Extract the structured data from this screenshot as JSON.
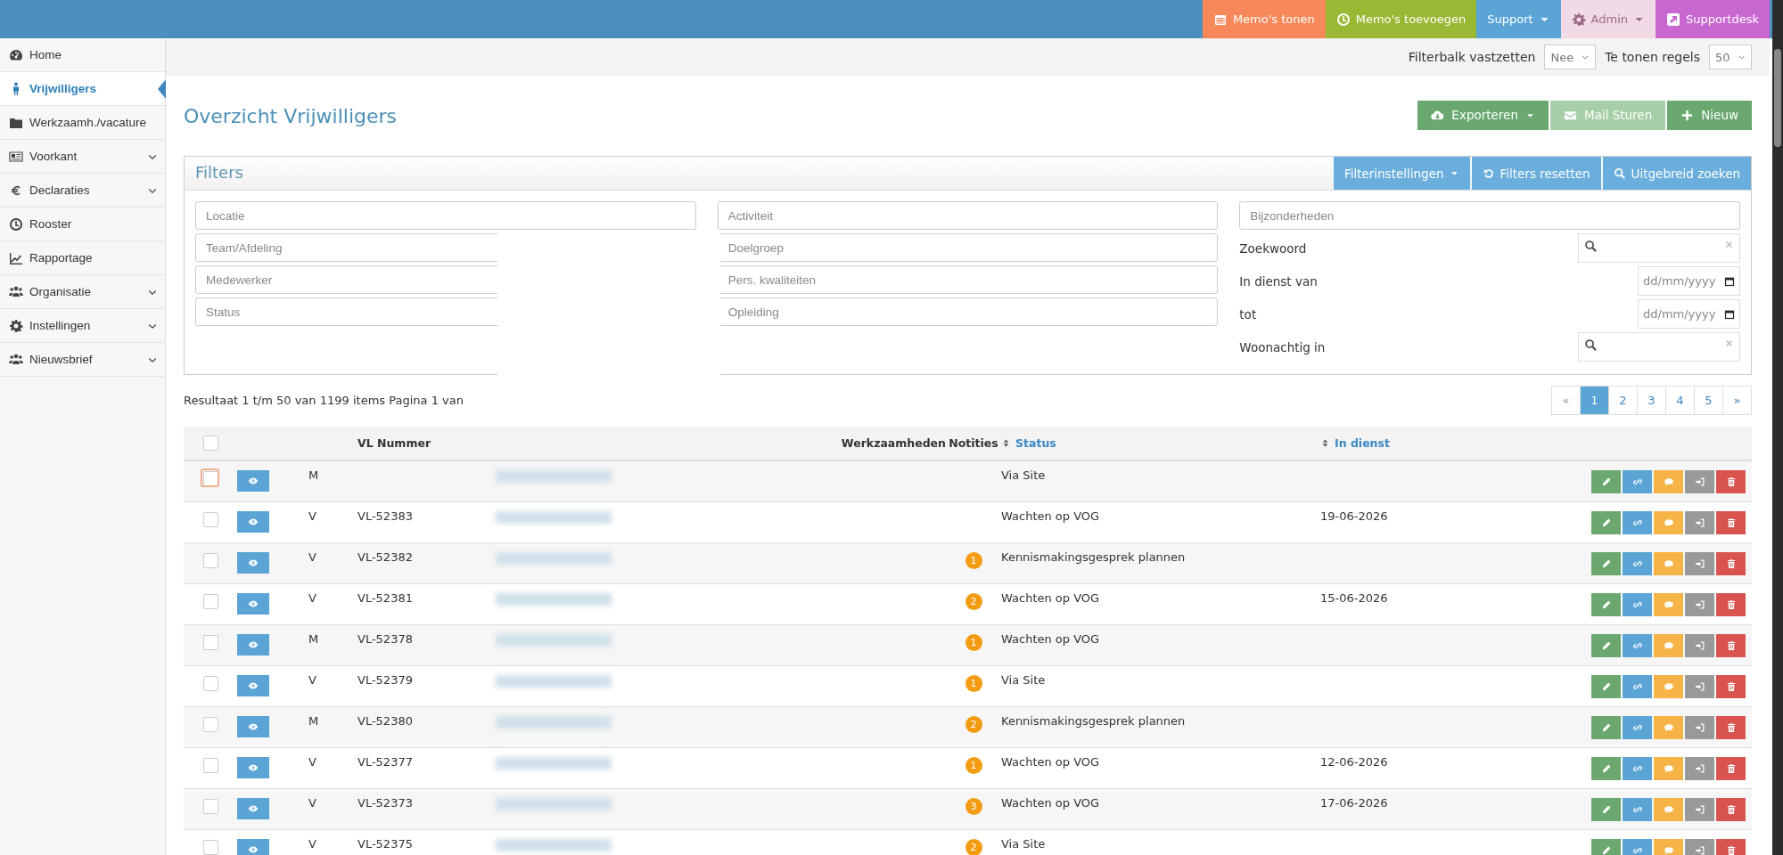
{
  "top_bar": {
    "buttons": [
      {
        "label": "Memo's tonen",
        "color": "#f7885a",
        "dropdown": false,
        "disabled": false
      },
      {
        "label": "Memo's toevoegen",
        "color": "#99b833",
        "dropdown": false,
        "disabled": false
      },
      {
        "label": "Support",
        "color": "#5aa4d6",
        "dropdown": true,
        "disabled": false
      },
      {
        "label": "Admin",
        "color": "#f2d9e6",
        "dropdown": true,
        "disabled": true
      },
      {
        "label": "Supportdesk",
        "color": "#c867cf",
        "dropdown": false,
        "disabled": false
      }
    ]
  },
  "sidebar": {
    "items": [
      {
        "label": "Home",
        "selected": false,
        "expandable": false
      },
      {
        "label": "Vrijwilligers",
        "selected": true,
        "expandable": false
      },
      {
        "label": "Werkzaamh./vacature",
        "selected": false,
        "expandable": false
      },
      {
        "label": "Voorkant",
        "selected": false,
        "expandable": true
      },
      {
        "label": "Declaraties",
        "selected": false,
        "expandable": true
      },
      {
        "label": "Rooster",
        "selected": false,
        "expandable": false
      },
      {
        "label": "Rapportage",
        "selected": false,
        "expandable": false
      },
      {
        "label": "Organisatie",
        "selected": false,
        "expandable": true
      },
      {
        "label": "Instellingen",
        "selected": false,
        "expandable": true
      },
      {
        "label": "Nieuwsbrief",
        "selected": false,
        "expandable": true
      }
    ]
  },
  "toolbar": {
    "pin_label": "Filterbalk vastzetten",
    "pin_value": "Nee",
    "rows_label": "Te tonen regels",
    "rows_value": "50"
  },
  "page_title": "Overzicht Vrijwilligers",
  "actions": [
    {
      "label": "Exporteren",
      "kind": "export",
      "disabled": false
    },
    {
      "label": "Mail Sturen",
      "kind": "mail",
      "disabled": true
    },
    {
      "label": "Nieuw",
      "kind": "new",
      "disabled": false
    }
  ],
  "filters": {
    "title": "Filters",
    "buttons": [
      {
        "label": "Filterinstellingen",
        "kind": "settings"
      },
      {
        "label": "Filters resetten",
        "kind": "reset"
      },
      {
        "label": "Uitgebreid zoeken",
        "kind": "search"
      }
    ],
    "column_1": [
      {
        "placeholder": "Locatie"
      },
      {
        "placeholder": "Team/Afdeling"
      },
      {
        "placeholder": "Medewerker"
      },
      {
        "placeholder": "Status"
      }
    ],
    "column_2": [
      {
        "placeholder": "Activiteit"
      },
      {
        "placeholder": "Doelgroep"
      },
      {
        "placeholder": "Pers. kwaliteiten"
      },
      {
        "placeholder": "Opleiding"
      }
    ],
    "column_3": {
      "placeholder": "Bijzonderheden",
      "fields": [
        {
          "label": "Zoekwoord",
          "kind": "search"
        },
        {
          "label": "In dienst van",
          "kind": "date",
          "placeholder": "dd/mm/yyyy"
        },
        {
          "label": "tot",
          "kind": "date",
          "placeholder": "dd/mm/yyyy"
        },
        {
          "label": "Woonachtig in",
          "kind": "search"
        }
      ]
    }
  },
  "result_text": "Resultaat 1 t/m 50 van 1199 items Pagina 1 van",
  "pagination": [
    {
      "label": "«",
      "selected": false
    },
    {
      "label": "1",
      "selected": true
    },
    {
      "label": "2",
      "selected": false
    },
    {
      "label": "3",
      "selected": false
    },
    {
      "label": "4",
      "selected": false
    },
    {
      "label": "5",
      "selected": false
    },
    {
      "label": "»",
      "selected": false
    }
  ],
  "table": {
    "header_checked": false,
    "columns": [
      {
        "label": "VL Nummer",
        "sortable": false
      },
      {
        "label": "Werkzaamheden",
        "sortable": false
      },
      {
        "label": "Notities",
        "sortable": false
      },
      {
        "label": "Status",
        "sortable": true
      },
      {
        "label": "In dienst",
        "sortable": true
      }
    ],
    "rows": [
      {
        "checked": false,
        "focused": true,
        "gender": "M",
        "vl_number": "",
        "notes": "",
        "status": "Via Site",
        "in_service": ""
      },
      {
        "checked": false,
        "focused": false,
        "gender": "V",
        "vl_number": "VL-52383",
        "notes": "",
        "status": "Wachten op VOG",
        "in_service": "19-06-2026"
      },
      {
        "checked": false,
        "focused": false,
        "gender": "V",
        "vl_number": "VL-52382",
        "notes": "1",
        "status": "Kennismakingsgesprek plannen",
        "in_service": ""
      },
      {
        "checked": false,
        "focused": false,
        "gender": "V",
        "vl_number": "VL-52381",
        "notes": "2",
        "status": "Wachten op VOG",
        "in_service": "15-06-2026"
      },
      {
        "checked": false,
        "focused": false,
        "gender": "M",
        "vl_number": "VL-52378",
        "notes": "1",
        "status": "Wachten op VOG",
        "in_service": ""
      },
      {
        "checked": false,
        "focused": false,
        "gender": "V",
        "vl_number": "VL-52379",
        "notes": "1",
        "status": "Via Site",
        "in_service": ""
      },
      {
        "checked": false,
        "focused": false,
        "gender": "M",
        "vl_number": "VL-52380",
        "notes": "2",
        "status": "Kennismakingsgesprek plannen",
        "in_service": ""
      },
      {
        "checked": false,
        "focused": false,
        "gender": "V",
        "vl_number": "VL-52377",
        "notes": "1",
        "status": "Wachten op VOG",
        "in_service": "12-06-2026"
      },
      {
        "checked": false,
        "focused": false,
        "gender": "V",
        "vl_number": "VL-52373",
        "notes": "3",
        "status": "Wachten op VOG",
        "in_service": "17-06-2026"
      },
      {
        "checked": false,
        "focused": false,
        "gender": "V",
        "vl_number": "VL-52375",
        "notes": "2",
        "status": "Via Site",
        "in_service": ""
      }
    ]
  }
}
